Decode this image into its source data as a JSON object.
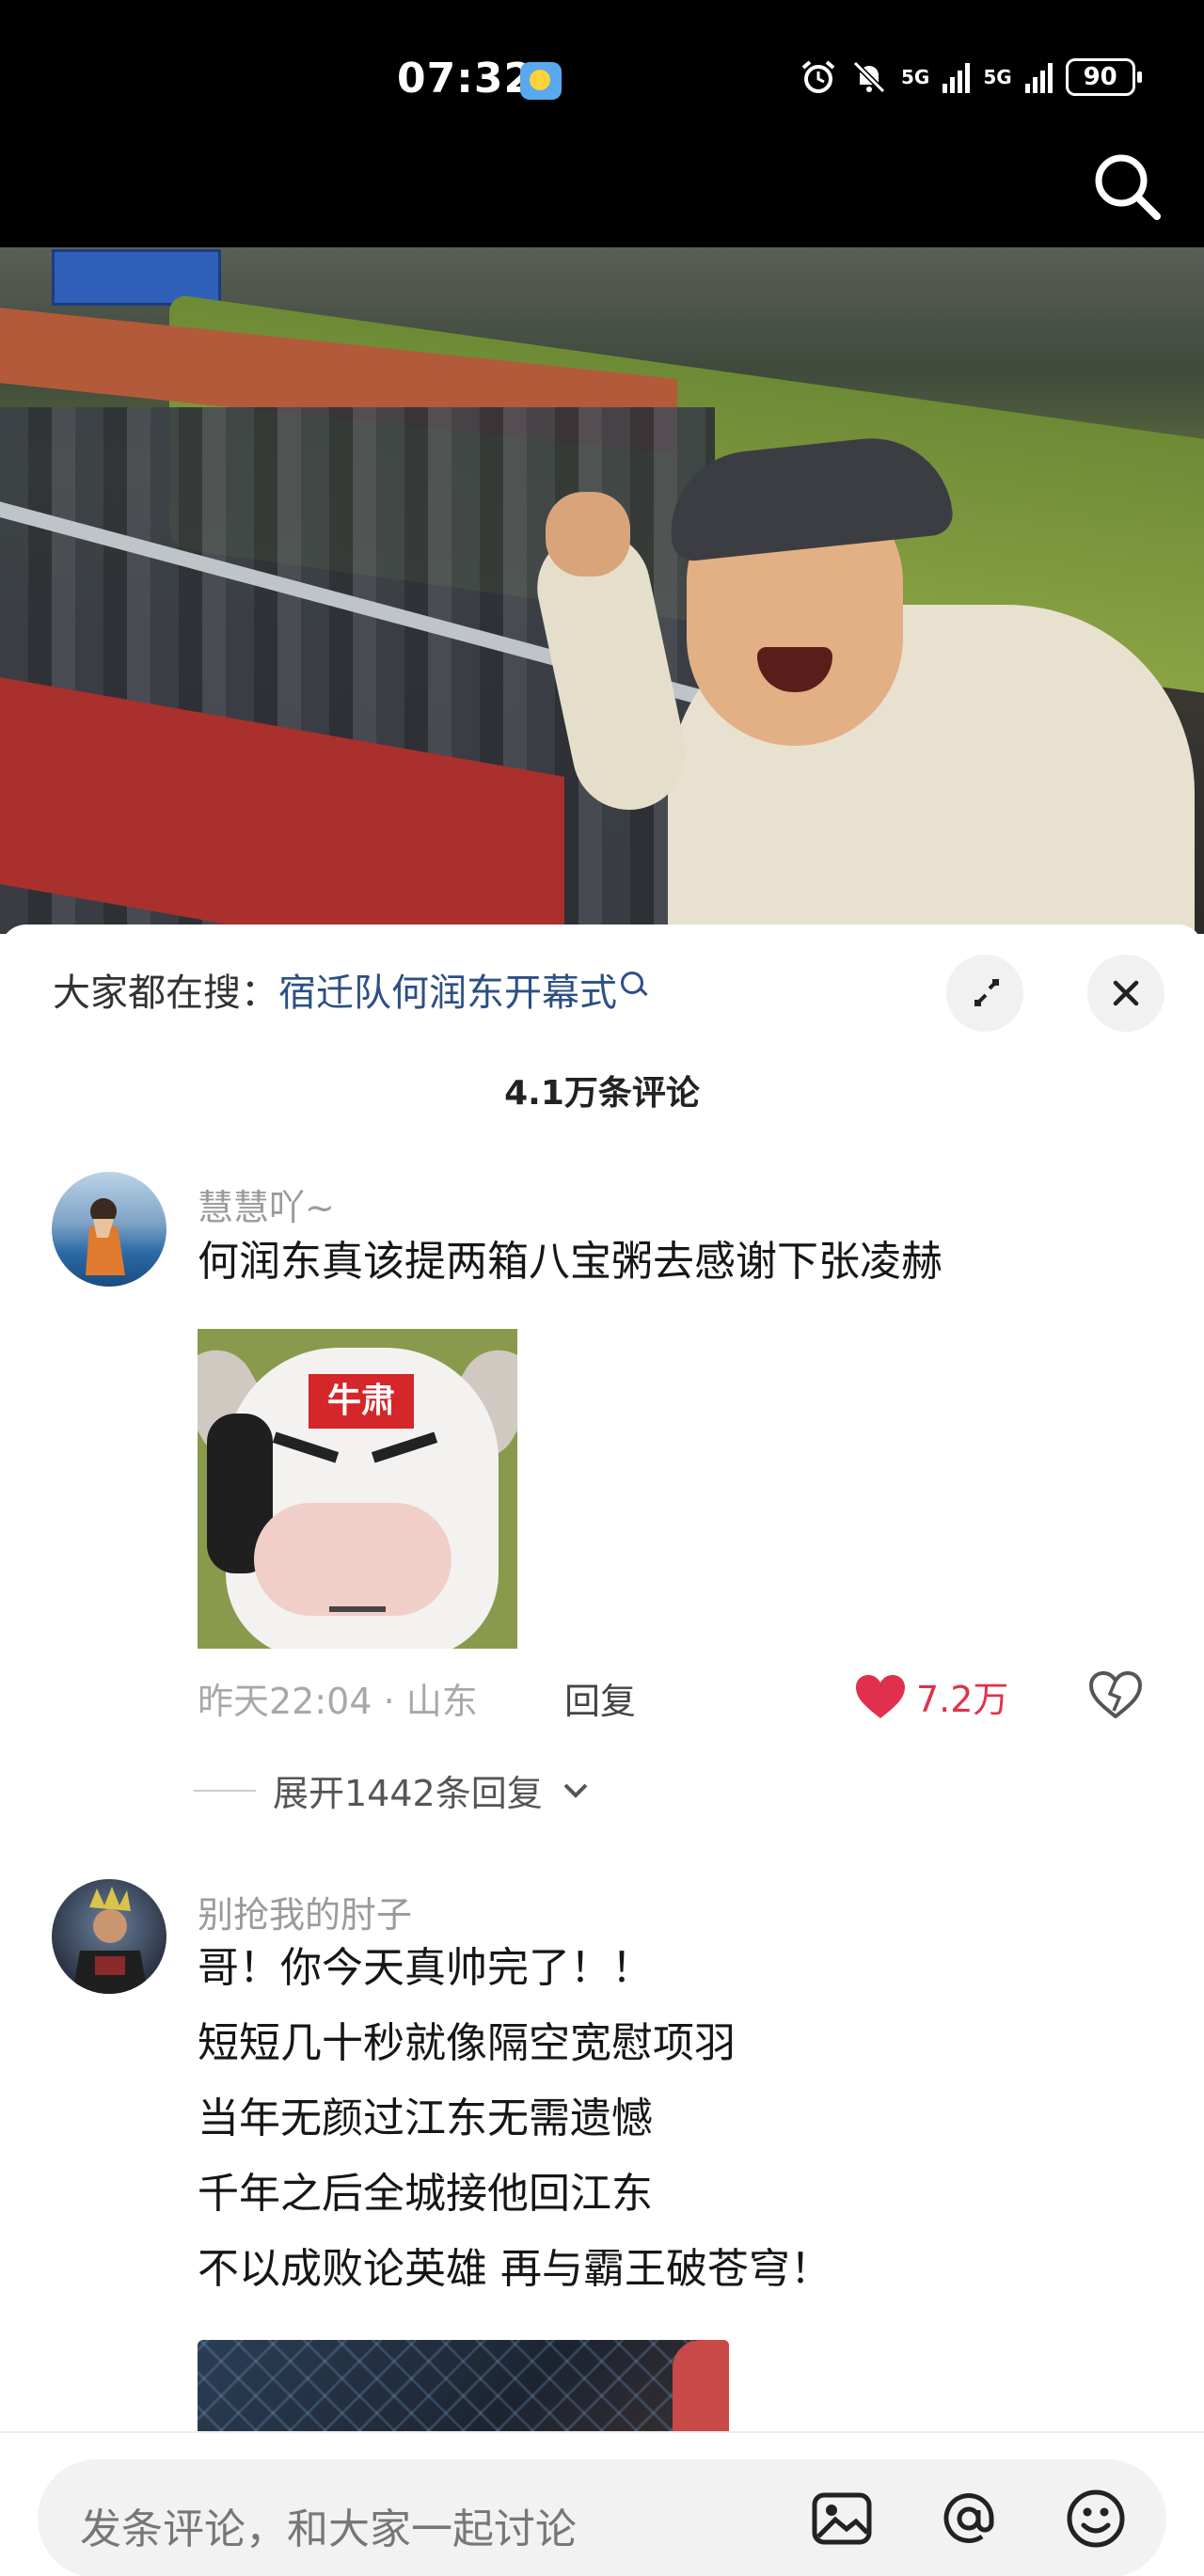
{
  "status_bar": {
    "time": "07:32",
    "network_1": "5G",
    "network_2": "5G",
    "battery": "90"
  },
  "hot_search": {
    "prefix": "大家都在搜：",
    "query": "宿迁队何润东开幕式"
  },
  "comments_header": {
    "count_label": "4.1万条评论"
  },
  "comments": [
    {
      "username": "慧慧吖~",
      "lines": [
        "何润东真该提两箱八宝粥去感谢下张凌赫"
      ],
      "sticker_text": "牛肃",
      "time_location": "昨天22:04 · 山东",
      "reply_label": "回复",
      "likes": "7.2万",
      "expand_label": "展开1442条回复"
    },
    {
      "username": "别抢我的肘子",
      "lines": [
        "哥！你今天真帅完了！！",
        "短短几十秒就像隔空宽慰项羽",
        "当年无颜过江东无需遗憾",
        "千年之后全城接他回江东",
        "不以成败论英雄 再与霸王破苍穹！"
      ]
    }
  ],
  "input": {
    "placeholder": "发条评论，和大家一起讨论"
  },
  "colors": {
    "link": "#2c4f86",
    "like": "#e1304d"
  }
}
